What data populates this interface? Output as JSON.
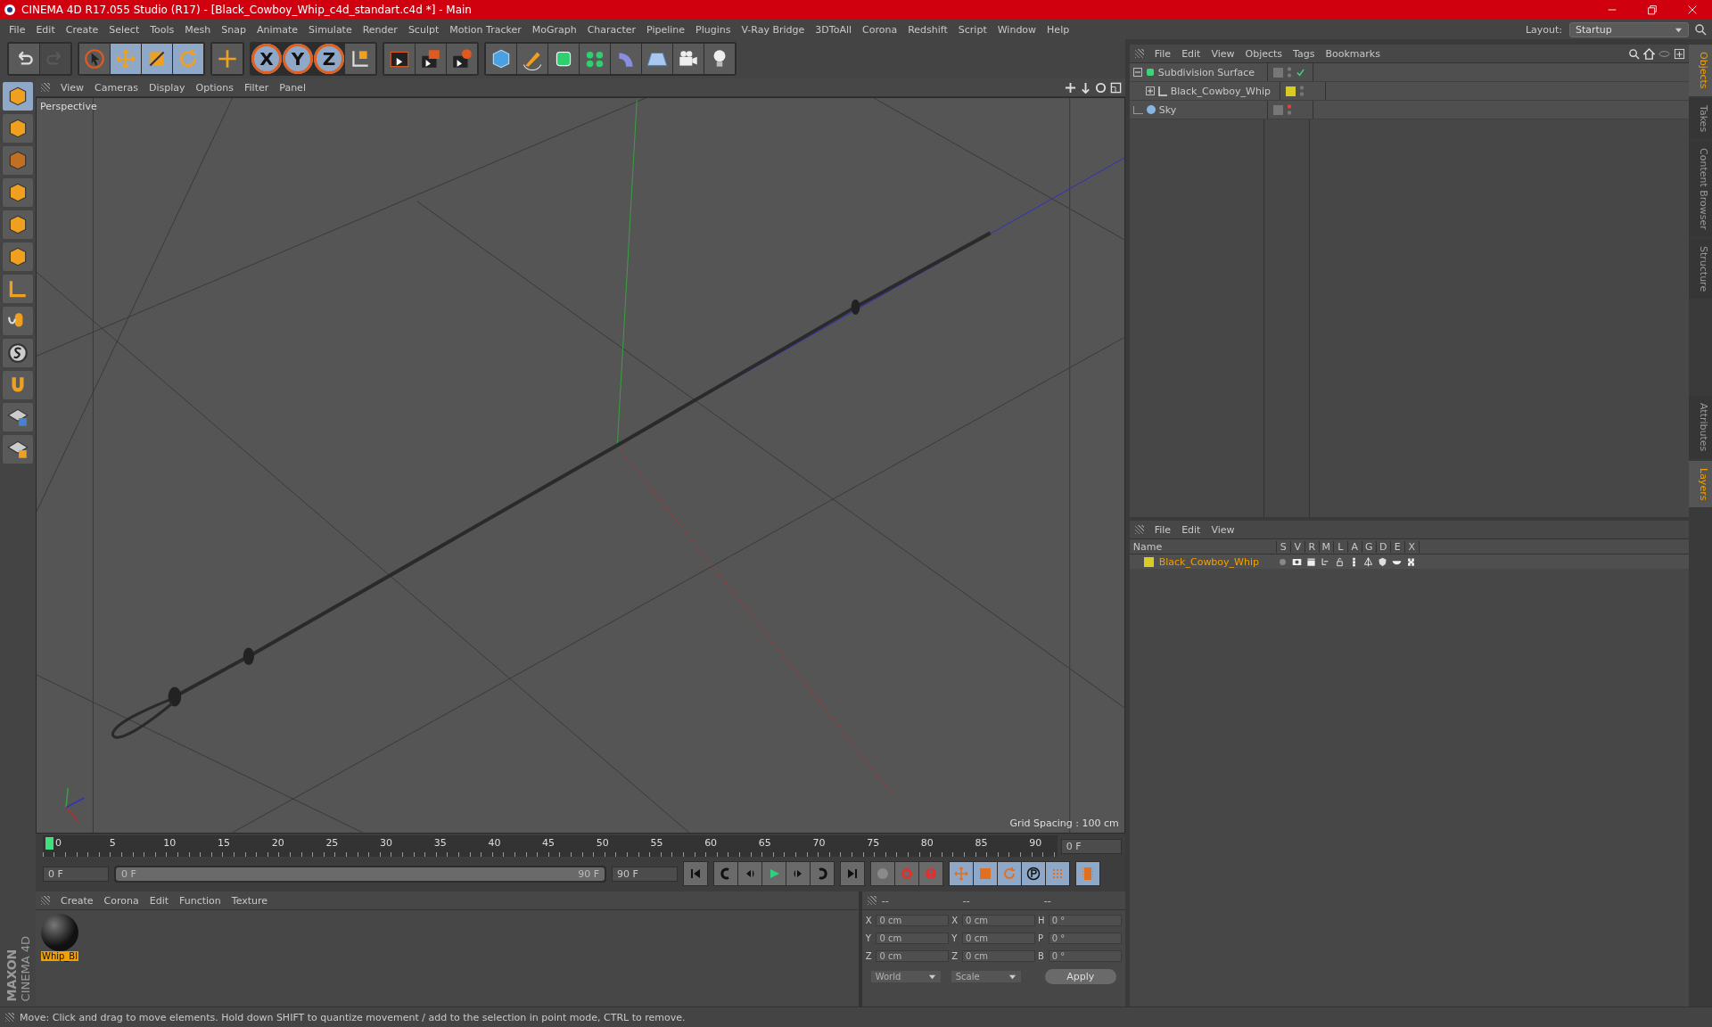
{
  "window": {
    "title": "CINEMA 4D R17.055 Studio (R17) - [Black_Cowboy_Whip_c4d_standart.c4d *] - Main"
  },
  "menu": [
    "File",
    "Edit",
    "Create",
    "Select",
    "Tools",
    "Mesh",
    "Snap",
    "Animate",
    "Simulate",
    "Render",
    "Sculpt",
    "Motion Tracker",
    "MoGraph",
    "Character",
    "Pipeline",
    "Plugins",
    "V-Ray Bridge",
    "3DToAll",
    "Corona",
    "Redshift",
    "Script",
    "Window",
    "Help"
  ],
  "layout": {
    "label": "Layout:",
    "value": "Startup"
  },
  "toolbar": {
    "axes": [
      "X",
      "Y",
      "Z"
    ]
  },
  "viewport": {
    "menu": [
      "View",
      "Cameras",
      "Display",
      "Options",
      "Filter",
      "Panel"
    ],
    "camera": "Perspective",
    "grid_spacing": "Grid Spacing : 100 cm"
  },
  "timeline": {
    "ruler_labels": [
      "0",
      "5",
      "10",
      "15",
      "20",
      "25",
      "30",
      "35",
      "40",
      "45",
      "50",
      "55",
      "60",
      "65",
      "70",
      "75",
      "80",
      "85",
      "90"
    ],
    "current_frame": "0 F",
    "start_field": "0 F",
    "range": {
      "start": "0 F",
      "end": "90 F",
      "level": 1
    },
    "end_field": "90 F"
  },
  "materials": {
    "menu": [
      "Create",
      "Corona",
      "Edit",
      "Function",
      "Texture"
    ],
    "items": [
      {
        "name": "Whip_Bl",
        "selected": true
      }
    ]
  },
  "coordinates": {
    "headers": [
      "--",
      "--",
      "--"
    ],
    "rows": [
      {
        "fields": [
          {
            "label": "X",
            "value": "0 cm"
          },
          {
            "label": "X",
            "value": "0 cm"
          },
          {
            "label": "H",
            "value": "0 °"
          }
        ]
      },
      {
        "fields": [
          {
            "label": "Y",
            "value": "0 cm"
          },
          {
            "label": "Y",
            "value": "0 cm"
          },
          {
            "label": "P",
            "value": "0 °"
          }
        ]
      },
      {
        "fields": [
          {
            "label": "Z",
            "value": "0 cm"
          },
          {
            "label": "Z",
            "value": "0 cm"
          },
          {
            "label": "B",
            "value": "0 °"
          }
        ]
      }
    ],
    "dropdowns": [
      "World",
      "Scale"
    ],
    "apply": "Apply"
  },
  "logo": {
    "brand": "MAXON",
    "product": "CINEMA 4D"
  },
  "objects": {
    "menu": [
      "File",
      "Edit",
      "View",
      "Objects",
      "Tags",
      "Bookmarks"
    ],
    "tree": [
      {
        "name": "Subdivision Surface",
        "kind": "generator",
        "expanded": true,
        "checked": true,
        "editor_visible": true,
        "children": [
          {
            "name": "Black_Cowboy_Whip",
            "kind": "null",
            "expanded": false,
            "editor_visible": true,
            "color": "#d8cc22"
          }
        ]
      },
      {
        "name": "Sky",
        "kind": "sky",
        "editor_visible": false
      }
    ]
  },
  "layers": {
    "menu": [
      "File",
      "Edit",
      "View"
    ],
    "columns": [
      "Name",
      "S",
      "V",
      "R",
      "M",
      "L",
      "A",
      "G",
      "D",
      "E",
      "X"
    ],
    "rows": [
      {
        "name": "Black_Cowboy_Whip",
        "color": "#d8cc22"
      }
    ]
  },
  "side_tabs_top": [
    {
      "label": "Objects",
      "selected": true
    },
    {
      "label": "Takes",
      "selected": false
    },
    {
      "label": "Content Browser",
      "selected": false
    },
    {
      "label": "Structure",
      "selected": false
    }
  ],
  "side_tabs_bottom": [
    {
      "label": "Attributes",
      "selected": false
    },
    {
      "label": "Layers",
      "selected": true
    }
  ],
  "status_bar": "Move: Click and drag to move elements. Hold down SHIFT to quantize movement / add to the selection in point mode, CTRL to remove."
}
